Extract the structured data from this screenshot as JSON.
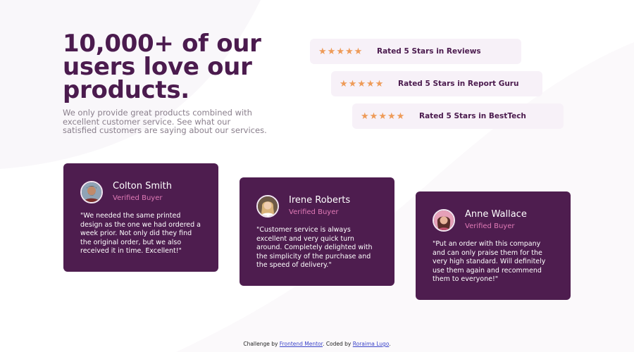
{
  "heading": "10,000+ of our users love our products.",
  "subtext": "We only provide great products combined with excellent customer service. See what our satisfied customers are saying about our services.",
  "colors": {
    "heading": "#4b1b4e",
    "card_bg": "#4e1d4f",
    "rating_bg": "#f7f1f8",
    "star": "#ee9b58",
    "verified": "#e07ab6",
    "link": "#3a43c9"
  },
  "ratings": [
    {
      "stars": 5,
      "label": "Rated 5 Stars in Reviews"
    },
    {
      "stars": 5,
      "label": "Rated 5 Stars in Report Guru"
    },
    {
      "stars": 5,
      "label": "Rated 5 Stars in BestTech"
    }
  ],
  "star_icon": "star-icon",
  "testimonials": [
    {
      "name": "Colton Smith",
      "badge": "Verified Buyer",
      "quote": "\"We needed the same printed design as the one we had ordered a week prior. Not only did they find the original order, but we also received it in time. Excellent!\""
    },
    {
      "name": "Irene Roberts",
      "badge": "Verified Buyer",
      "quote": "\"Customer service is always excellent and very quick turn around. Completely delighted with the simplicity of the purchase and the speed of delivery.\""
    },
    {
      "name": "Anne Wallace",
      "badge": "Verified Buyer",
      "quote": "\"Put an order with this company and can only praise them for the very high standard. Will definitely use them again and recommend them to everyone!\""
    }
  ],
  "footer": {
    "prefix": "Challenge by ",
    "link1": "Frontend Mentor",
    "middle": ". Coded by ",
    "link2": "Roraima Lugo",
    "suffix": "."
  }
}
